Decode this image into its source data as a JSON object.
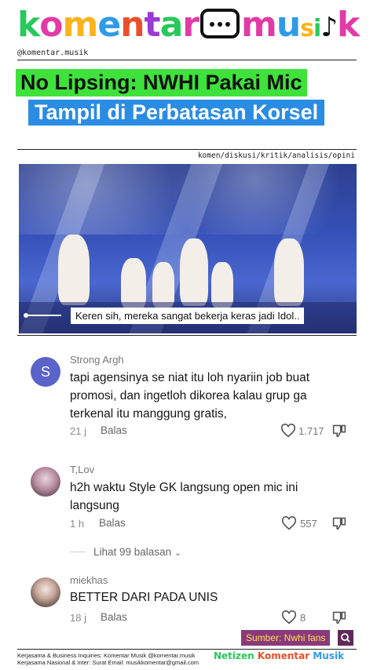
{
  "brand": {
    "logo": [
      "k",
      "o",
      "m",
      "e",
      "n",
      "t",
      "a",
      "r",
      "m",
      "u",
      "s",
      "i",
      "k"
    ],
    "handle": "@komentar.musik",
    "tags": "komen/diskusi/kritik/analisis/opini"
  },
  "headline": {
    "line1": "No Lipsing: NWHI Pakai Mic",
    "line2": "Tampil di Perbatasan Korsel"
  },
  "video": {
    "caption": "Keren sih, mereka sangat bekerja keras jadi Idol.."
  },
  "comments": [
    {
      "user": "Strong Argh",
      "avatar_letter": "S",
      "avatar_color": "#5a63c9",
      "text": "tapi agensinya se niat itu loh nyariin job buat promosi, dan ingetloh dikorea kalau grup ga terkenal itu manggung gratis,",
      "time": "21 j",
      "reply": "Balas",
      "likes": "1.717"
    },
    {
      "user": "T,Lov",
      "text": "h2h waktu Style GK langsung open mic ini langsung",
      "time": "1 h",
      "reply": "Balas",
      "likes": "557",
      "view_replies": "Lihat 99 balasan"
    },
    {
      "user": "miekhas",
      "text": "BETTER DARI PADA UNIS",
      "time": "18 j",
      "reply": "Balas",
      "likes": "8"
    }
  ],
  "source": "Sumber: Nwhi fans",
  "footer": {
    "line1": "Kerjasama & Business Inquiries: Komentar Musik @komentar.musik",
    "line2": "Kerjasama Nasional & Inter: Surat Email: musikkomentar@gmail.com",
    "logo": "Netizen Komentar Musik"
  },
  "colors": {
    "green": "#3ee23a",
    "blue": "#2b8ce4",
    "source_bg": "#8a3a7c"
  }
}
